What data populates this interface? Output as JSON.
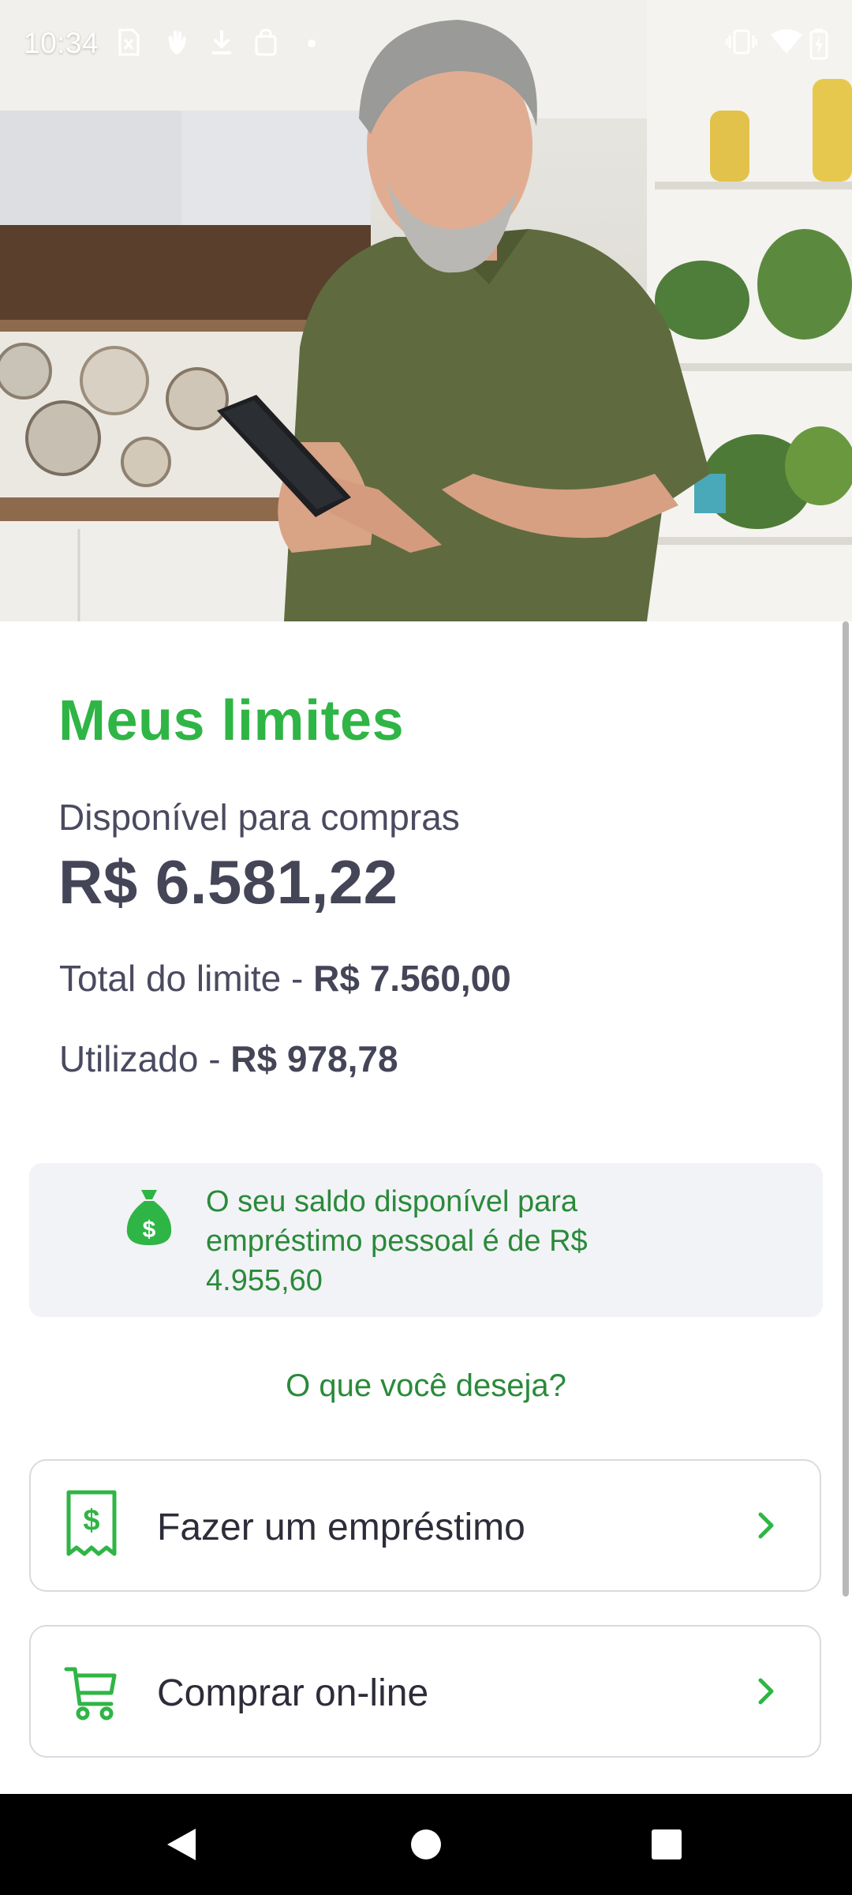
{
  "status_bar": {
    "time": "10:34",
    "icons_left": [
      "sim-off-icon",
      "hand-icon",
      "download-icon",
      "bag-icon",
      "dot-icon"
    ],
    "icons_right": [
      "vibrate-icon",
      "wifi-icon",
      "battery-charging-icon"
    ]
  },
  "hero": {
    "image": "man-smiling-using-phone-photo"
  },
  "limits": {
    "title": "Meus limites",
    "available_label": "Disponível para compras",
    "available_value": "R$ 6.581,22",
    "total_label": "Total do limite - ",
    "total_value": "R$ 7.560,00",
    "used_label": "Utilizado - ",
    "used_value": "R$ 978,78"
  },
  "loan_info": {
    "icon": "money-bag-icon",
    "text": "O seu saldo disponível para empréstimo pessoal é de R$ 4.955,60"
  },
  "question": "O que você deseja?",
  "actions": [
    {
      "icon": "receipt-dollar-icon",
      "label": "Fazer um empréstimo"
    },
    {
      "icon": "shopping-cart-icon",
      "label": "Comprar on-line"
    }
  ],
  "colors": {
    "brand_green": "#2fb545",
    "dark_green_text": "#2a8a3a",
    "text_dark": "#454558",
    "info_box_bg": "#f2f3f6"
  },
  "nav_bar": [
    "back-icon",
    "home-icon",
    "recents-icon"
  ]
}
